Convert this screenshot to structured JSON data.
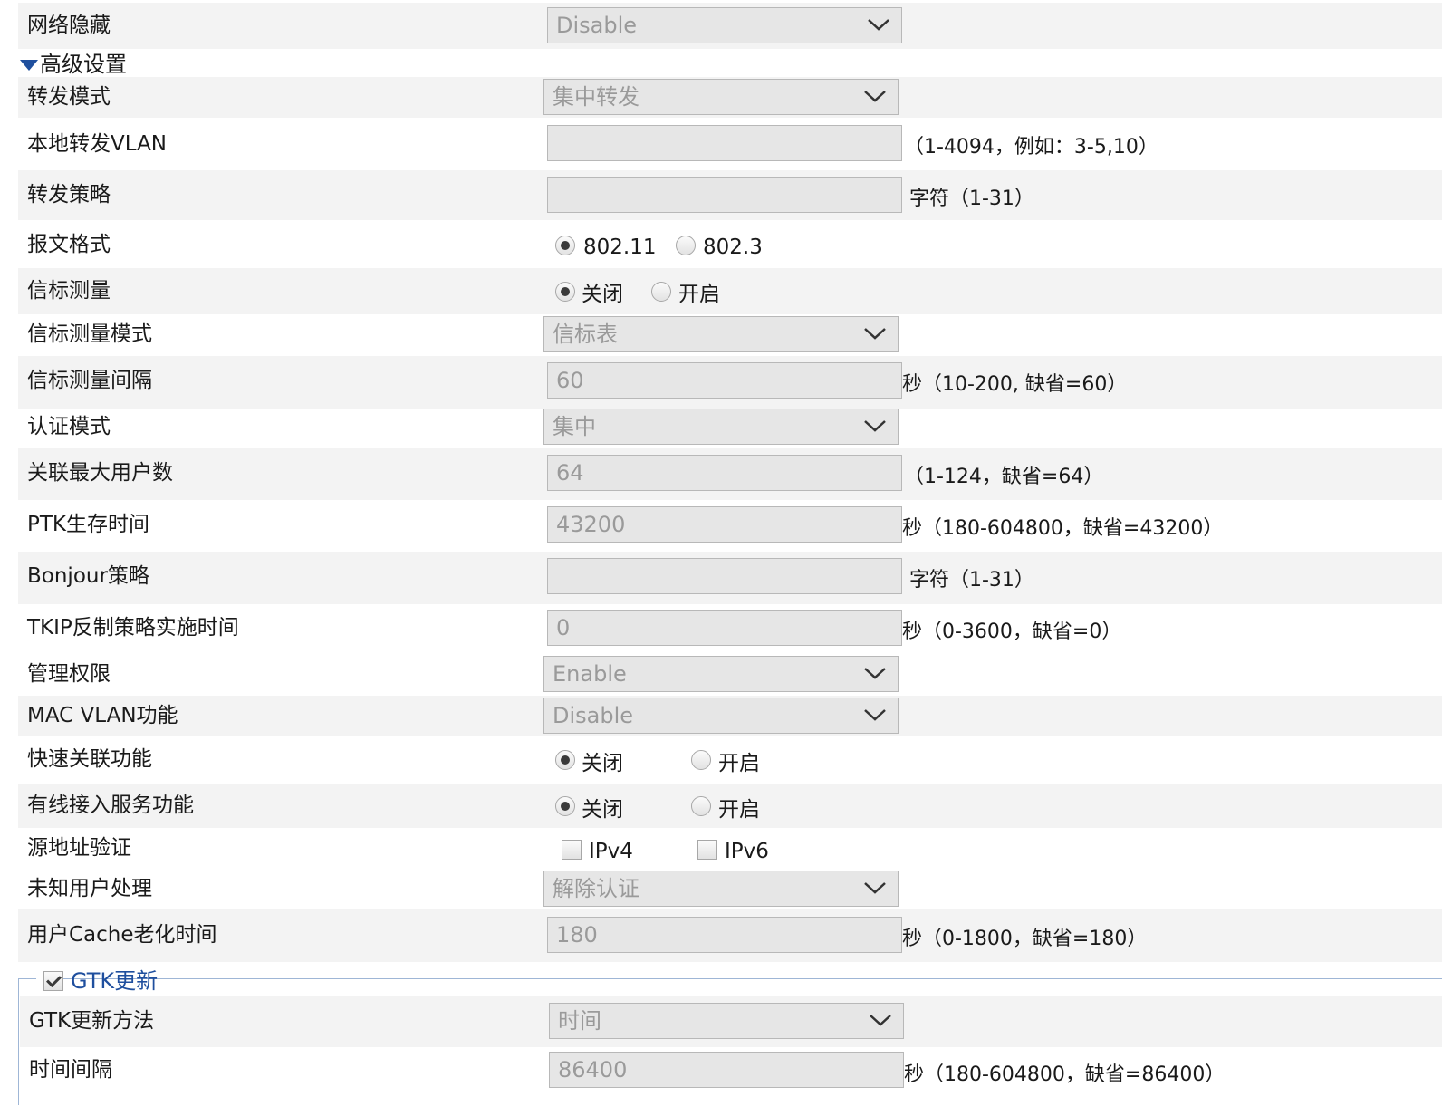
{
  "rows": {
    "hidden_network": {
      "label": "网络隐藏",
      "value": "Disable"
    },
    "advanced_settings": {
      "label": "高级设置"
    },
    "forward_mode": {
      "label": "转发模式",
      "value": "集中转发"
    },
    "local_forward_vlan": {
      "label": "本地转发VLAN",
      "value": "",
      "hint": "（1-4094，例如：3-5,10）"
    },
    "forward_policy": {
      "label": "转发策略",
      "value": "",
      "hint": "字符（1-31）"
    },
    "frame_format": {
      "label": "报文格式",
      "options": [
        "802.11",
        "802.3"
      ],
      "selected": "802.11"
    },
    "beacon_measure": {
      "label": "信标测量",
      "options": [
        "关闭",
        "开启"
      ],
      "selected": "关闭"
    },
    "beacon_measure_mode": {
      "label": "信标测量模式",
      "value": "信标表"
    },
    "beacon_measure_interval": {
      "label": "信标测量间隔",
      "value": "60",
      "hint": "秒（10-200, 缺省=60）"
    },
    "auth_mode": {
      "label": "认证模式",
      "value": "集中"
    },
    "max_users": {
      "label": "关联最大用户数",
      "value": "64",
      "hint": "（1-124，缺省=64）"
    },
    "ptk_lifetime": {
      "label": "PTK生存时间",
      "value": "43200",
      "hint": "秒（180-604800，缺省=43200）"
    },
    "bonjour_policy": {
      "label": "Bonjour策略",
      "value": "",
      "hint": "字符（1-31）"
    },
    "tkip_countermeasure": {
      "label": "TKIP反制策略实施时间",
      "value": "0",
      "hint": "秒（0-3600，缺省=0）"
    },
    "management_privilege": {
      "label": "管理权限",
      "value": "Enable"
    },
    "mac_vlan": {
      "label": "MAC VLAN功能",
      "value": "Disable"
    },
    "fast_association": {
      "label": "快速关联功能",
      "options": [
        "关闭",
        "开启"
      ],
      "selected": "关闭"
    },
    "wired_access": {
      "label": "有线接入服务功能",
      "options": [
        "关闭",
        "开启"
      ],
      "selected": "关闭"
    },
    "source_address_verify": {
      "label": "源地址验证",
      "options": [
        "IPv4",
        "IPv6"
      ],
      "checked": []
    },
    "unknown_user_handling": {
      "label": "未知用户处理",
      "value": "解除认证"
    },
    "user_cache_aging": {
      "label": "用户Cache老化时间",
      "value": "180",
      "hint": "秒（0-1800，缺省=180）"
    }
  },
  "gtk": {
    "legend": "GTK更新",
    "checked": true,
    "method": {
      "label": "GTK更新方法",
      "value": "时间"
    },
    "interval": {
      "label": "时间间隔",
      "value": "86400",
      "hint": "秒（180-604800，缺省=86400）"
    }
  },
  "icons": {
    "select_arrow": "chevron-down-icon",
    "section_toggle": "triangle-down-icon"
  }
}
